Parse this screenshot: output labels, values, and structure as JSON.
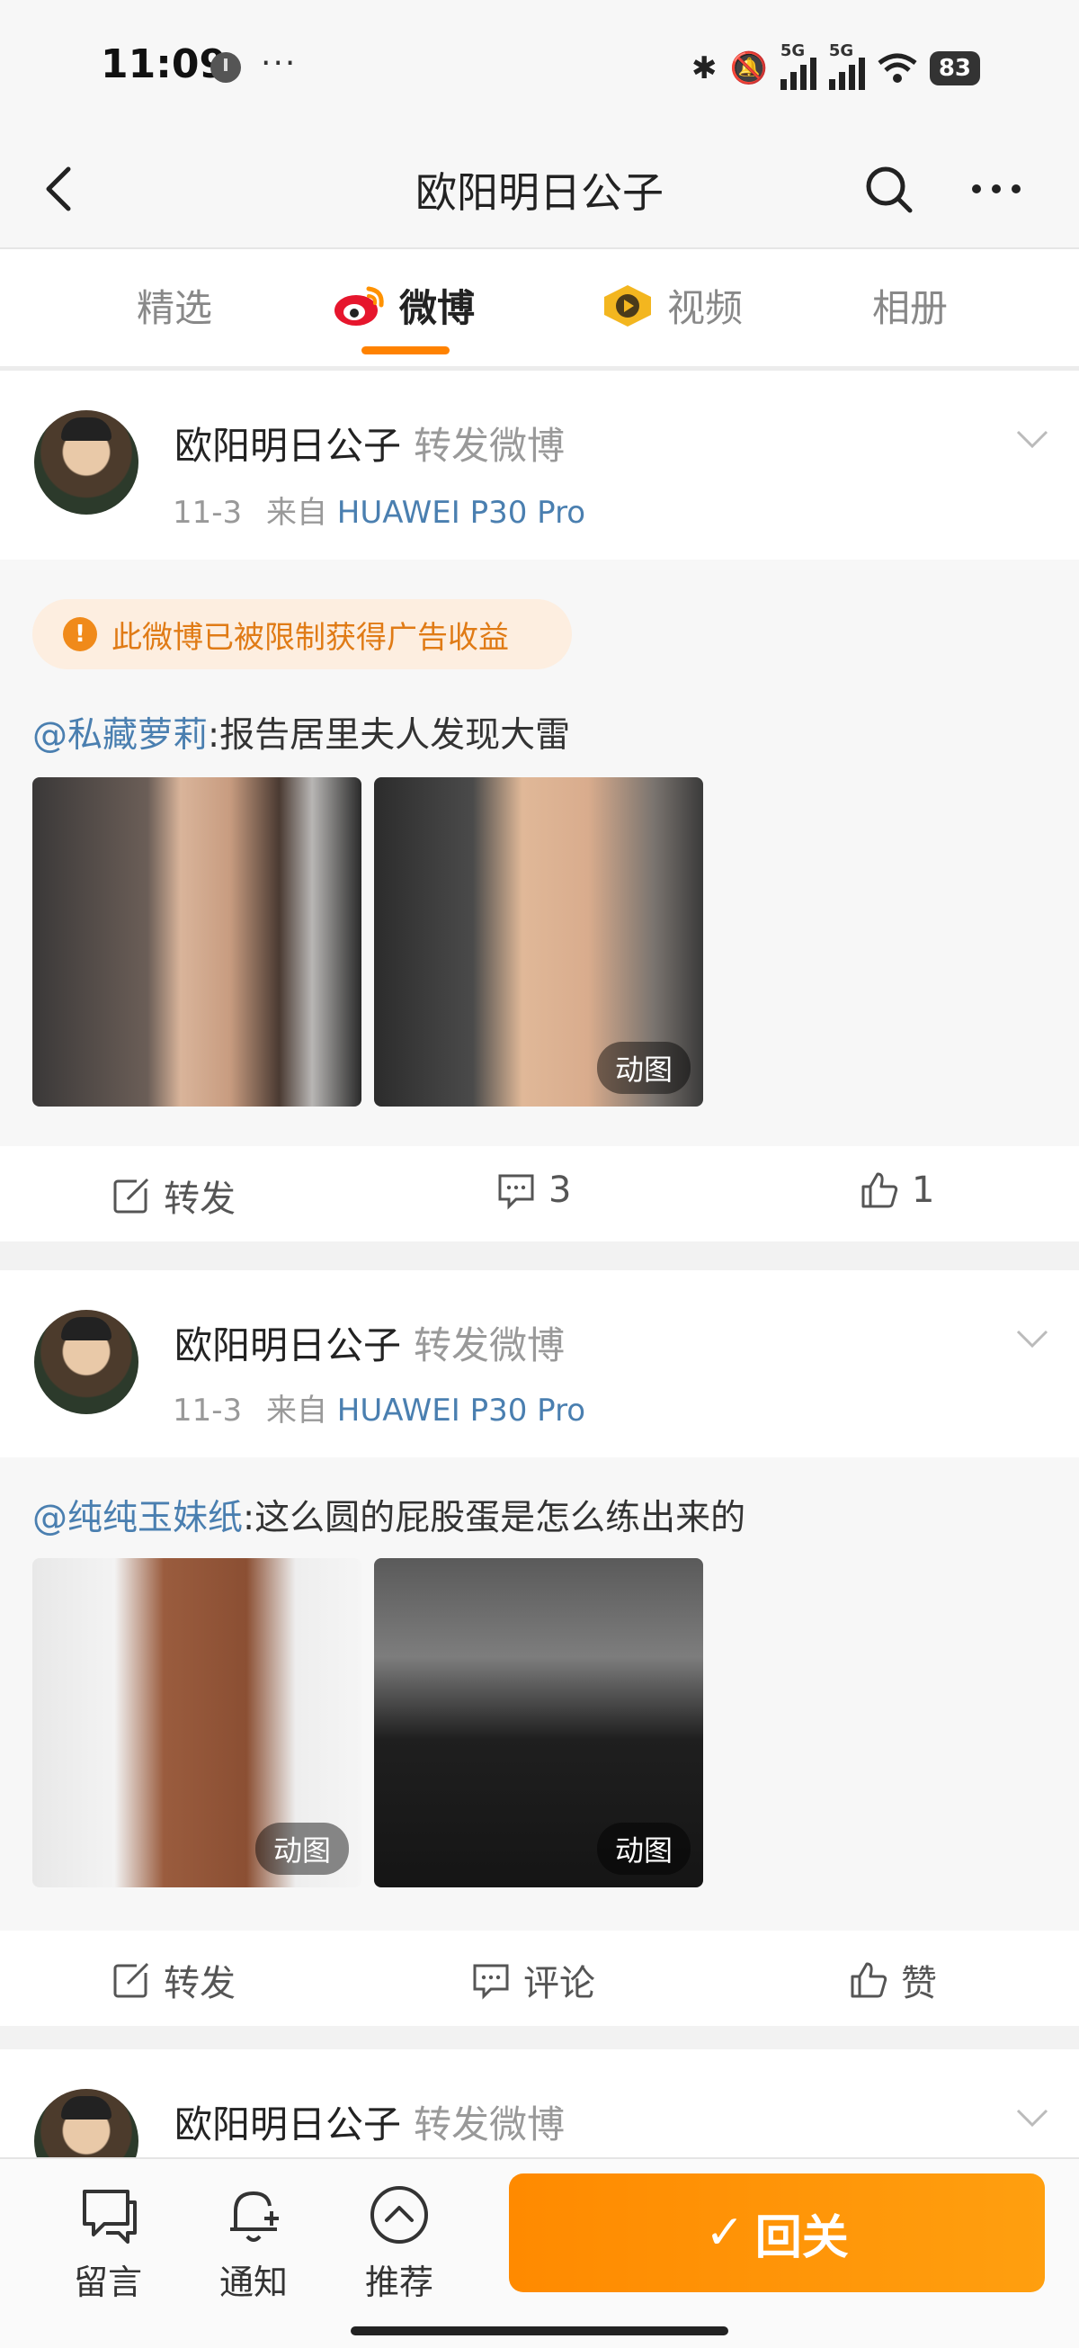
{
  "status_bar": {
    "time": "11:09",
    "dots": "···",
    "network_label": "5G",
    "battery": "83"
  },
  "nav": {
    "title": "欧阳明日公子"
  },
  "tabs": [
    {
      "label": "精选"
    },
    {
      "label": "微博"
    },
    {
      "label": "视频"
    },
    {
      "label": "相册"
    }
  ],
  "posts": [
    {
      "author": "欧阳明日公子",
      "action": "转发微博",
      "date": "11-3",
      "from_prefix": "来自",
      "source": "HUAWEI P30 Pro",
      "warning": "此微博已被限制获得广告收益",
      "mention": "@私藏萝莉",
      "text": ":报告居里夫人发现大雷",
      "images": [
        {
          "badge": ""
        },
        {
          "badge": "动图"
        }
      ],
      "actions": {
        "repost": "转发",
        "comments": "3",
        "likes": "1"
      }
    },
    {
      "author": "欧阳明日公子",
      "action": "转发微博",
      "date": "11-3",
      "from_prefix": "来自",
      "source": "HUAWEI P30 Pro",
      "mention": "@纯纯玉妹纸",
      "text": ":这么圆的屁股蛋是怎么练出来的",
      "images": [
        {
          "badge": "动图"
        },
        {
          "badge": "动图"
        }
      ],
      "actions": {
        "repost": "转发",
        "comments": "评论",
        "likes": "赞"
      }
    },
    {
      "author": "欧阳明日公子",
      "action": "转发微博"
    }
  ],
  "bottom_bar": {
    "message": "留言",
    "notify": "通知",
    "recommend": "推荐",
    "follow": "回关"
  },
  "colors": {
    "accent": "#ff8200",
    "link": "#4a7fb0",
    "warning": "#e07b16"
  }
}
